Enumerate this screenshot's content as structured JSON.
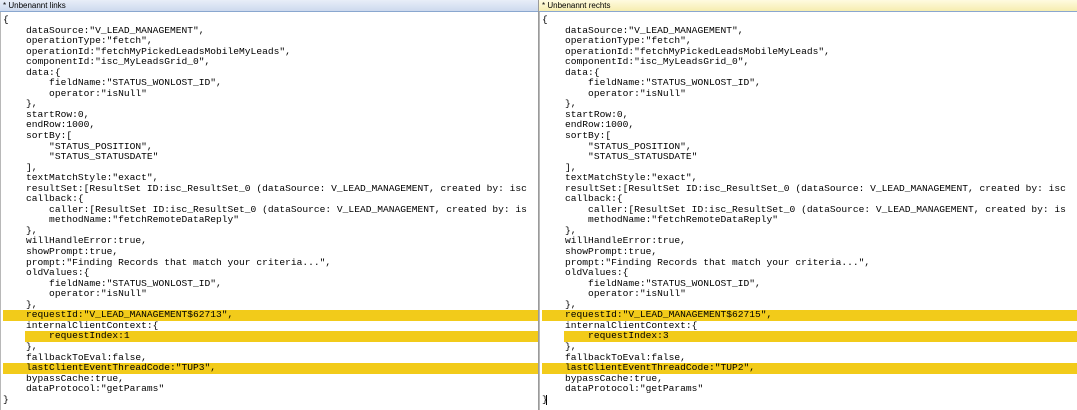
{
  "left": {
    "title": "* Unbenannt links",
    "lines": [
      "{",
      "    dataSource:\"V_LEAD_MANAGEMENT\",",
      "    operationType:\"fetch\",",
      "    operationId:\"fetchMyPickedLeadsMobileMyLeads\",",
      "    componentId:\"isc_MyLeadsGrid_0\",",
      "    data:{",
      "        fieldName:\"STATUS_WONLOST_ID\",",
      "        operator:\"isNull\"",
      "    },",
      "    startRow:0,",
      "    endRow:1000,",
      "    sortBy:[",
      "        \"STATUS_POSITION\",",
      "        \"STATUS_STATUSDATE\"",
      "    ],",
      "    textMatchStyle:\"exact\",",
      "    resultSet:[ResultSet ID:isc_ResultSet_0 (dataSource: V_LEAD_MANAGEMENT, created by: isc",
      "    callback:{",
      "        caller:[ResultSet ID:isc_ResultSet_0 (dataSource: V_LEAD_MANAGEMENT, created by: is",
      "        methodName:\"fetchRemoteDataReply\"",
      "    },",
      "    willHandleError:true,",
      "    showPrompt:true,",
      "    prompt:\"Finding Records that match your criteria...\",",
      "    oldValues:{",
      "        fieldName:\"STATUS_WONLOST_ID\",",
      "        operator:\"isNull\"",
      "    },",
      "    requestId:\"V_LEAD_MANAGEMENT$62713\",",
      "    internalClientContext:{",
      "        requestIndex:1",
      "    },",
      "    fallbackToEval:false,",
      "    lastClientEventThreadCode:\"TUP3\",",
      "    bypassCache:true,",
      "    dataProtocol:\"getParams\"",
      "}"
    ]
  },
  "right": {
    "title": "* Unbenannt rechts",
    "lines": [
      "{",
      "    dataSource:\"V_LEAD_MANAGEMENT\",",
      "    operationType:\"fetch\",",
      "    operationId:\"fetchMyPickedLeadsMobileMyLeads\",",
      "    componentId:\"isc_MyLeadsGrid_0\",",
      "    data:{",
      "        fieldName:\"STATUS_WONLOST_ID\",",
      "        operator:\"isNull\"",
      "    },",
      "    startRow:0,",
      "    endRow:1000,",
      "    sortBy:[",
      "        \"STATUS_POSITION\",",
      "        \"STATUS_STATUSDATE\"",
      "    ],",
      "    textMatchStyle:\"exact\",",
      "    resultSet:[ResultSet ID:isc_ResultSet_0 (dataSource: V_LEAD_MANAGEMENT, created by: isc",
      "    callback:{",
      "        caller:[ResultSet ID:isc_ResultSet_0 (dataSource: V_LEAD_MANAGEMENT, created by: is",
      "        methodName:\"fetchRemoteDataReply\"",
      "    },",
      "    willHandleError:true,",
      "    showPrompt:true,",
      "    prompt:\"Finding Records that match your criteria...\",",
      "    oldValues:{",
      "        fieldName:\"STATUS_WONLOST_ID\",",
      "        operator:\"isNull\"",
      "    },",
      "    requestId:\"V_LEAD_MANAGEMENT$62715\",",
      "    internalClientContext:{",
      "        requestIndex:3",
      "    },",
      "    fallbackToEval:false,",
      "    lastClientEventThreadCode:\"TUP2\",",
      "    bypassCache:true,",
      "    dataProtocol:\"getParams\"",
      "}"
    ]
  },
  "diff": {
    "changed_lines": [
      28,
      33
    ],
    "changed_inner_lines": [
      30
    ],
    "highlight_color": "#f2cb1a",
    "highlight_inner_color": "#fff6cf"
  }
}
